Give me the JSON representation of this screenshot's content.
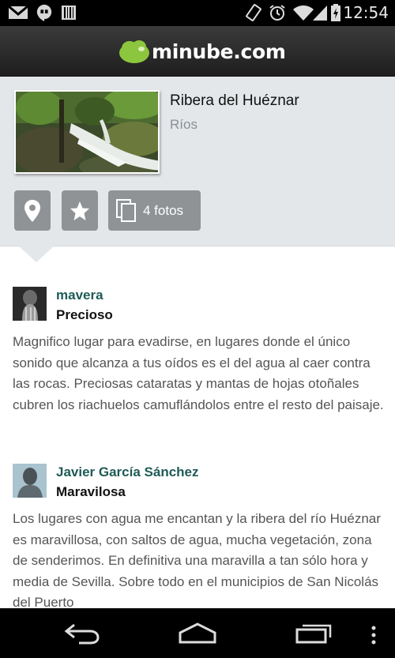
{
  "status_bar": {
    "time": "12:54",
    "icons": [
      "gmail-icon",
      "hangouts-icon",
      "barcode-icon",
      "vibrate-icon",
      "alarm-icon",
      "wifi-icon",
      "signal-icon",
      "battery-charging-icon"
    ]
  },
  "header": {
    "logo_text": "minube.com"
  },
  "place": {
    "title": "Ribera del Huéznar",
    "category": "Ríos",
    "photo_alt": "waterfall-photo",
    "actions": {
      "location_icon": "map-pin-icon",
      "favorite_icon": "star-icon",
      "photos_icon": "photos-icon",
      "photos_label": "4 fotos"
    }
  },
  "reviews": [
    {
      "author": "mavera",
      "title": "Precioso",
      "body": "Magnifico lugar para evadirse, en lugares donde el único sonido que alcanza a tus oídos es el del agua al caer contra las rocas. Preciosas cataratas y mantas de hojas otoñales cubren los riachuelos camuflándolos entre el resto del paisaje."
    },
    {
      "author": "Javier García Sánchez",
      "title": "Maravilosa",
      "body": "Los lugares con agua me encantan y la ribera del río Huéznar es maravillosa, con saltos de agua, mucha vegetación, zona de senderimos. En definitiva una maravilla a tan sólo hora y media de Sevilla. Sobre todo en el municipios de San Nicolás del Puerto"
    }
  ],
  "nav": {
    "back_icon": "back-icon",
    "home_icon": "home-icon",
    "recents_icon": "recent-apps-icon",
    "menu_icon": "overflow-menu-icon"
  }
}
